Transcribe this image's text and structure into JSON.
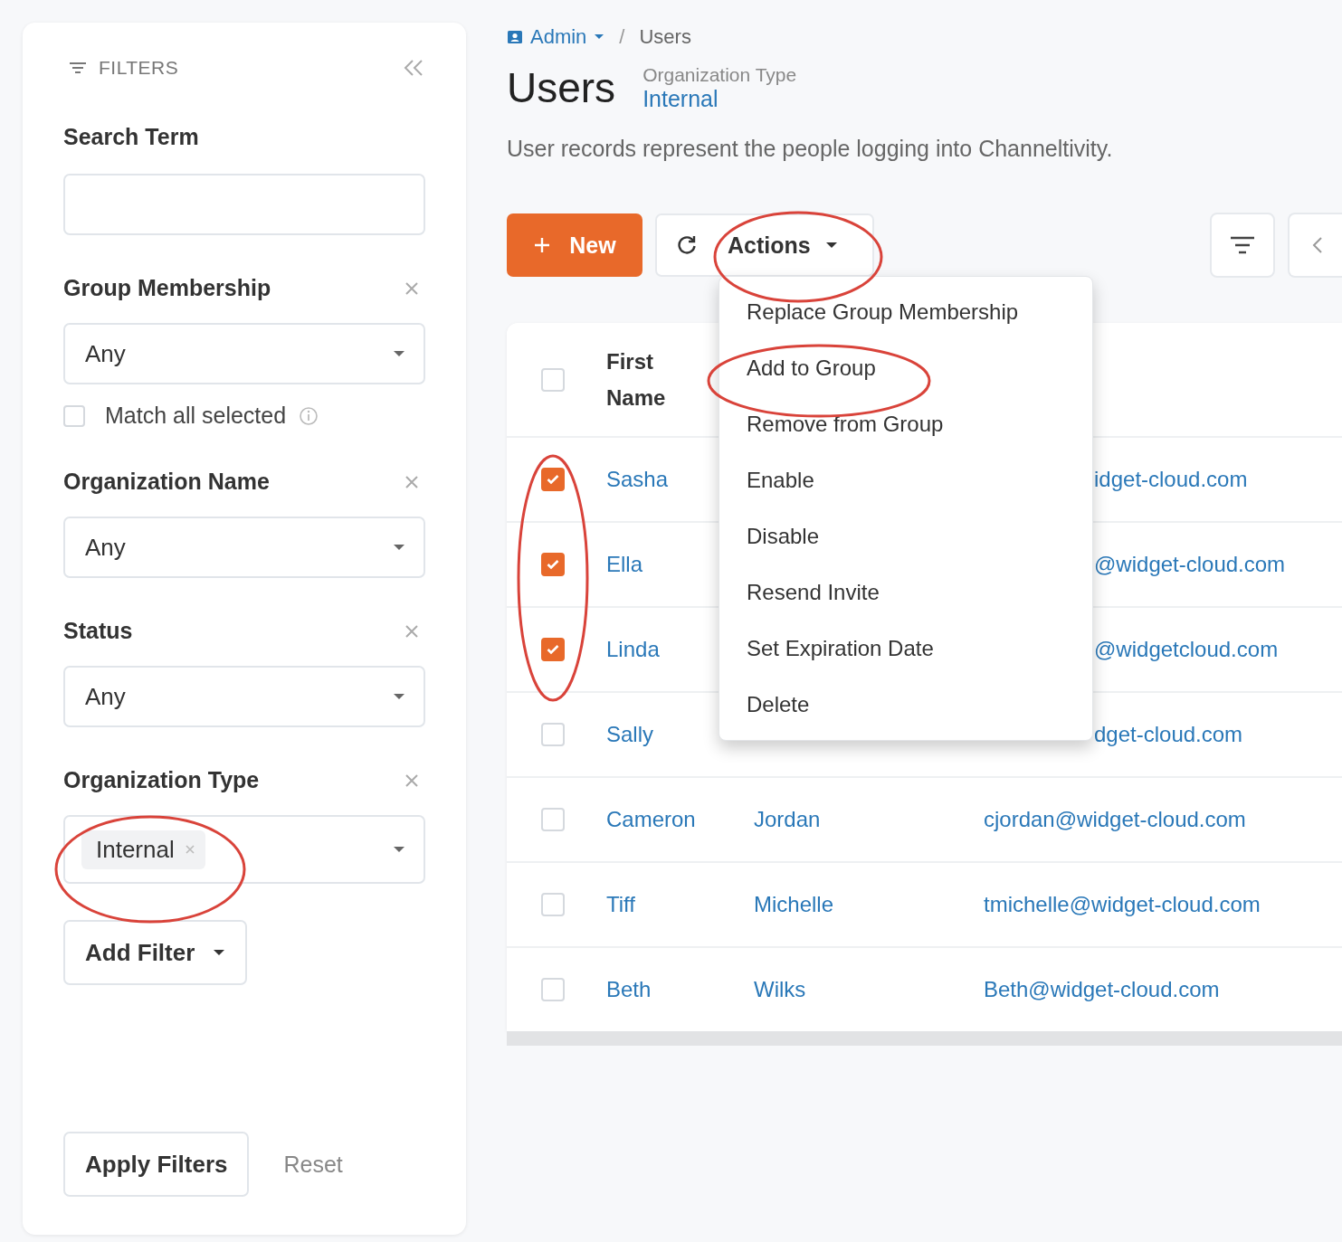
{
  "breadcrumb": {
    "items": [
      {
        "label": "Admin",
        "kind": "menu"
      },
      {
        "label": "Users",
        "kind": "current"
      }
    ],
    "separator": "/"
  },
  "page": {
    "title": "Users",
    "context_label": "Organization Type",
    "context_value": "Internal",
    "description": "User records represent the people logging into Channeltivity."
  },
  "filters": {
    "title": "FILTERS",
    "search_label": "Search Term",
    "groups": [
      {
        "label": "Group Membership",
        "kind": "select",
        "value": "Any",
        "option": {
          "label": "Match all selected",
          "checked": false
        }
      },
      {
        "label": "Organization Name",
        "kind": "select",
        "value": "Any"
      },
      {
        "label": "Status",
        "kind": "select",
        "value": "Any"
      },
      {
        "label": "Organization Type",
        "kind": "tags",
        "tags": [
          "Internal"
        ]
      }
    ],
    "add_filter": "Add Filter",
    "apply": "Apply Filters",
    "reset": "Reset"
  },
  "toolbar": {
    "new": "New",
    "actions": "Actions"
  },
  "actions_menu": [
    "Replace Group Membership",
    "Add to Group",
    "Remove from Group",
    "Enable",
    "Disable",
    "Resend Invite",
    "Set Expiration Date",
    "Delete"
  ],
  "table": {
    "all_selected": false,
    "columns": [
      "First Name"
    ],
    "rows": [
      {
        "selected": true,
        "covered": true,
        "first_name": "Sasha",
        "email": "idget-cloud.com"
      },
      {
        "selected": true,
        "covered": true,
        "first_name": "Ella",
        "email": "@widget-cloud.com"
      },
      {
        "selected": true,
        "covered": true,
        "first_name": "Linda",
        "email": "@widgetcloud.com"
      },
      {
        "selected": false,
        "covered": true,
        "first_name": "Sally",
        "email": "dget-cloud.com"
      },
      {
        "selected": false,
        "covered": false,
        "first_name": "Cameron",
        "last_name": "Jordan",
        "email": "cjordan@widget-cloud.com"
      },
      {
        "selected": false,
        "covered": false,
        "first_name": "Tiff",
        "last_name": "Michelle",
        "email": "tmichelle@widget-cloud.com"
      },
      {
        "selected": false,
        "covered": false,
        "first_name": "Beth",
        "last_name": "Wilks",
        "email": "Beth@widget-cloud.com"
      }
    ]
  }
}
